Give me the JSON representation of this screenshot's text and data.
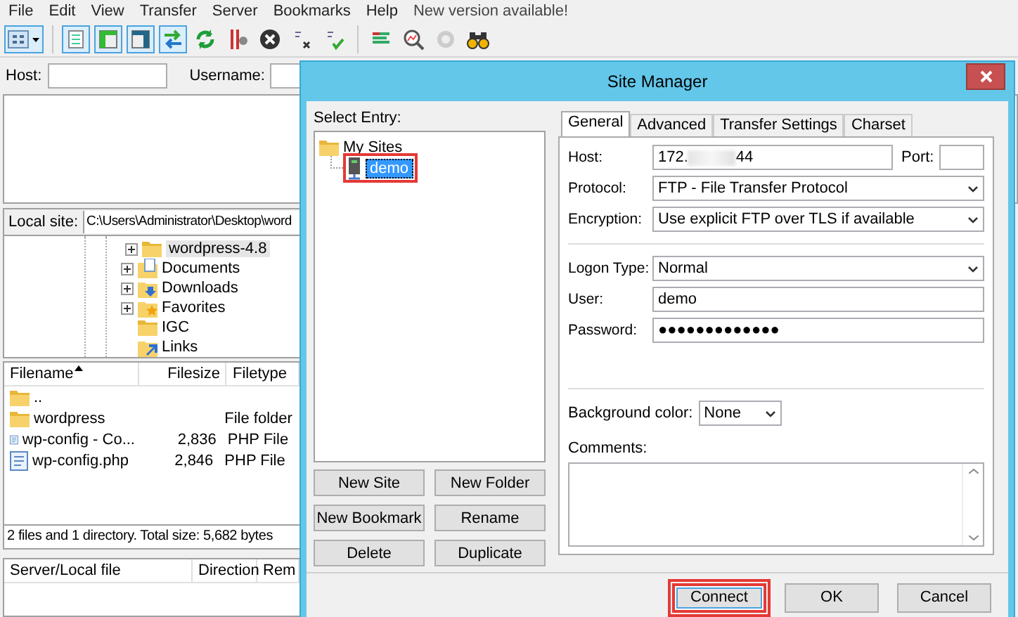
{
  "menu": [
    "File",
    "Edit",
    "View",
    "Transfer",
    "Server",
    "Bookmarks",
    "Help"
  ],
  "update_notice": "New version available!",
  "panel_toggles": [
    {
      "on": true
    },
    {
      "on": true
    },
    {
      "on": true
    },
    {
      "on": true
    }
  ],
  "quickconnect": {
    "host_label": "Host:",
    "username_label": "Username:"
  },
  "local_site": {
    "label": "Local site:",
    "path": "C:\\Users\\Administrator\\Desktop\\word"
  },
  "local_tree": {
    "desktop_children": [
      {
        "name": "wordpress-4.8",
        "kind": "folder",
        "expandable": true,
        "selected": true
      }
    ],
    "items": [
      {
        "name": "Documents",
        "kind": "documents",
        "expandable": true,
        "selected": false
      },
      {
        "name": "Downloads",
        "kind": "downloads",
        "expandable": true,
        "selected": false
      },
      {
        "name": "Favorites",
        "kind": "favorites",
        "expandable": true,
        "selected": false
      },
      {
        "name": "IGC",
        "kind": "folder",
        "expandable": false,
        "selected": false
      },
      {
        "name": "Links",
        "kind": "links",
        "expandable": false,
        "selected": false
      }
    ]
  },
  "local_files": {
    "columns": [
      {
        "label": "Filename",
        "sorted": true
      },
      {
        "label": "Filesize",
        "sorted": false
      },
      {
        "label": "Filetype",
        "sorted": false
      }
    ],
    "rows": [
      {
        "kind": "folder",
        "name": ".."
      },
      {
        "kind": "folder",
        "name": "wordpress",
        "type": "File folder"
      },
      {
        "kind": "php",
        "name": "wp-config - Co...",
        "size": "2,836",
        "type": "PHP File"
      },
      {
        "kind": "php",
        "name": "wp-config.php",
        "size": "2,846",
        "type": "PHP File"
      }
    ]
  },
  "local_status": "2 files and 1 directory. Total size: 5,682 bytes",
  "queue": {
    "columns": [
      "Server/Local file",
      "Direction",
      "Rem"
    ]
  },
  "site_manager": {
    "title": "Site Manager",
    "select_label": "Select Entry:",
    "tree": [
      {
        "name": "My Sites",
        "kind": "folder",
        "selected": false,
        "highlighted": false,
        "children": [
          {
            "name": "demo",
            "kind": "server",
            "selected": true,
            "highlighted": true
          }
        ]
      }
    ],
    "entry_buttons": [
      "New Site",
      "New Folder",
      "New Bookmark",
      "Rename",
      "Delete",
      "Duplicate"
    ],
    "tabs": [
      {
        "label": "General",
        "selected": true
      },
      {
        "label": "Advanced",
        "selected": false
      },
      {
        "label": "Transfer Settings",
        "selected": false
      },
      {
        "label": "Charset",
        "selected": false
      }
    ],
    "host": {
      "label": "Host:",
      "value_start": "172.",
      "value_end": "44",
      "blurred": true
    },
    "port": {
      "label": "Port:"
    },
    "protocol": {
      "label": "Protocol:",
      "value": "FTP - File Transfer Protocol"
    },
    "encryption": {
      "label": "Encryption:",
      "value": "Use explicit FTP over TLS if available"
    },
    "logon_type": {
      "label": "Logon Type:",
      "value": "Normal"
    },
    "user": {
      "label": "User:",
      "value": "demo"
    },
    "password": {
      "label": "Password:",
      "value": "●●●●●●●●●●●●●"
    },
    "background_color": {
      "label": "Background color:",
      "value": "None"
    },
    "comments": {
      "label": "Comments:"
    },
    "buttons": [
      {
        "label": "Connect",
        "highlighted": true
      },
      {
        "label": "OK",
        "highlighted": false
      },
      {
        "label": "Cancel",
        "highlighted": false
      }
    ]
  }
}
